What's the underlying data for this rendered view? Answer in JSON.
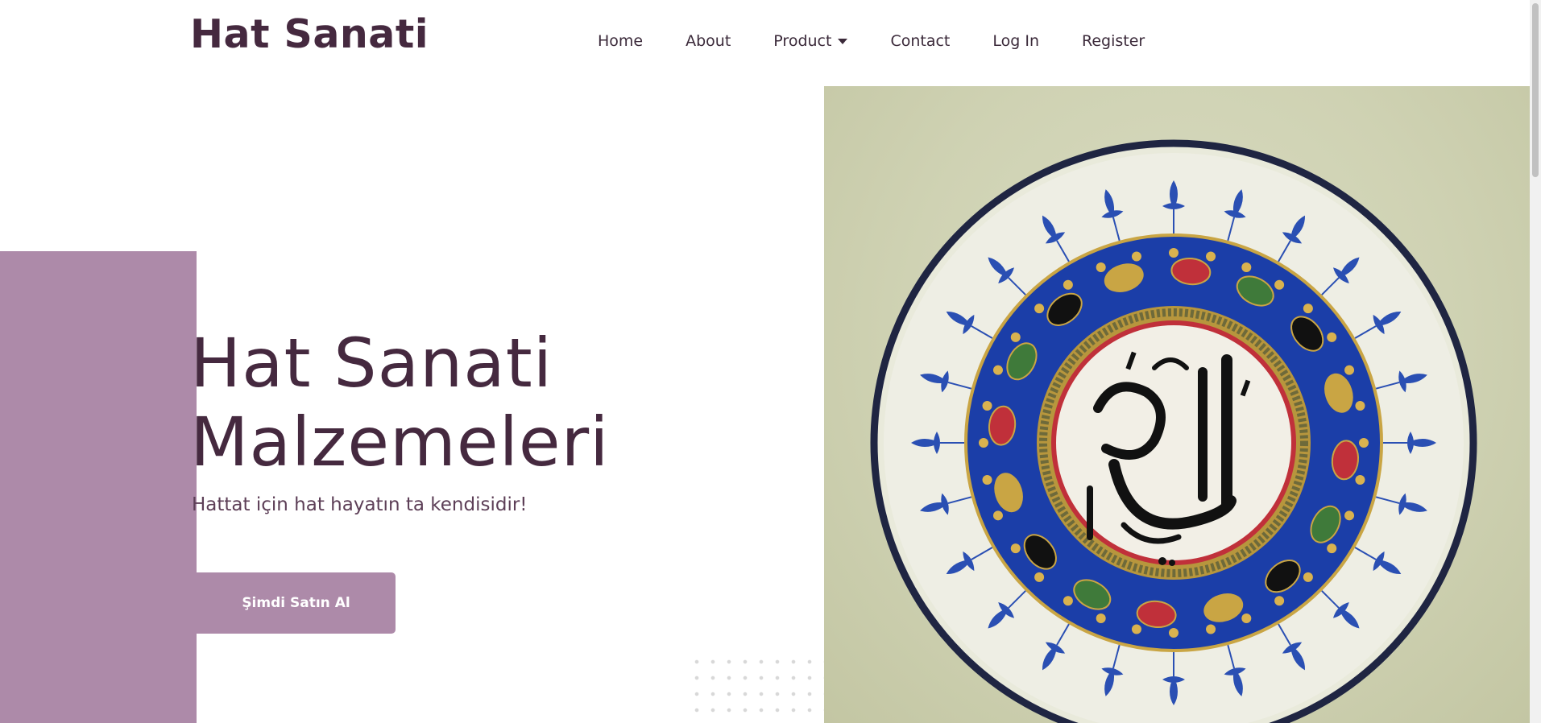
{
  "brand": "Hat Sanati",
  "nav": {
    "home": "Home",
    "about": "About",
    "product": "Product",
    "contact": "Contact",
    "login": "Log In",
    "register": "Register"
  },
  "hero": {
    "title_line1": "Hat Sanati",
    "title_line2": "Malzemeleri",
    "subtitle": "Hattat için hat hayatın ta kendisidir!",
    "cta": "Şimdi Satın Al"
  },
  "colors": {
    "primary_dark": "#45293f",
    "accent": "#ad8aa9",
    "text": "#3b2a3a"
  },
  "icons": {
    "dropdown": "caret-down-icon"
  }
}
